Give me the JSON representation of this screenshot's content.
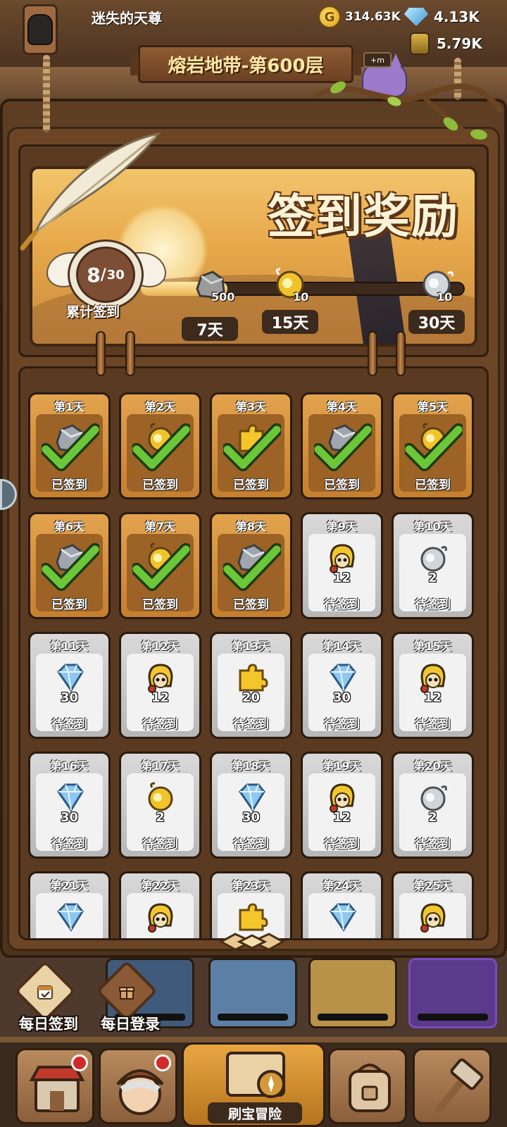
{
  "player": {
    "name": "迷失的天尊"
  },
  "currencies": {
    "coins": {
      "symbol": "G",
      "value": "314.63K",
      "color": "#f2b51f"
    },
    "gems": {
      "value": "4.13K",
      "color": "#5cb8ea"
    },
    "potions": {
      "value": "5.79K"
    }
  },
  "stage": {
    "title": "熔岩地带-第600层"
  },
  "pet_badge": "+m",
  "signin": {
    "title": "签到奖励",
    "progress": {
      "current": "8",
      "total": "30",
      "caption": "累计签到",
      "fraction": 0.267
    },
    "milestones": [
      {
        "reward": "stone-icon",
        "qty": "500",
        "day": "7天"
      },
      {
        "reward": "gold-scroll-icon",
        "qty": "10",
        "day": "15天"
      },
      {
        "reward": "silver-scroll-icon",
        "qty": "10",
        "day": "30天"
      }
    ]
  },
  "days": [
    {
      "day": "第1天",
      "reward": "stone-icon",
      "amount": "",
      "status": "已签到",
      "done": true
    },
    {
      "day": "第2天",
      "reward": "gold-scroll-icon",
      "amount": "",
      "status": "已签到",
      "done": true
    },
    {
      "day": "第3天",
      "reward": "puzzle-icon",
      "amount": "",
      "status": "已签到",
      "done": true
    },
    {
      "day": "第4天",
      "reward": "stone-icon",
      "amount": "",
      "status": "已签到",
      "done": true
    },
    {
      "day": "第5天",
      "reward": "gold-scroll-icon",
      "amount": "",
      "status": "已签到",
      "done": true
    },
    {
      "day": "第6天",
      "reward": "stone-icon",
      "amount": "",
      "status": "已签到",
      "done": true
    },
    {
      "day": "第7天",
      "reward": "gold-scroll-icon",
      "amount": "",
      "status": "已签到",
      "done": true
    },
    {
      "day": "第8天",
      "reward": "stone-icon",
      "amount": "",
      "status": "已签到",
      "done": true
    },
    {
      "day": "第9天",
      "reward": "hero-token-icon",
      "amount": "12",
      "status": "待签到",
      "done": false
    },
    {
      "day": "第10天",
      "reward": "silver-scroll-icon",
      "amount": "2",
      "status": "待签到",
      "done": false
    },
    {
      "day": "第11天",
      "reward": "gem-icon",
      "amount": "30",
      "status": "待签到",
      "done": false
    },
    {
      "day": "第12天",
      "reward": "hero-token-icon",
      "amount": "12",
      "status": "待签到",
      "done": false
    },
    {
      "day": "第13天",
      "reward": "puzzle-icon",
      "amount": "20",
      "status": "待签到",
      "done": false
    },
    {
      "day": "第14天",
      "reward": "gem-icon",
      "amount": "30",
      "status": "待签到",
      "done": false
    },
    {
      "day": "第15天",
      "reward": "hero-token-icon",
      "amount": "12",
      "status": "待签到",
      "done": false
    },
    {
      "day": "第16天",
      "reward": "gem-icon",
      "amount": "30",
      "status": "待签到",
      "done": false
    },
    {
      "day": "第17天",
      "reward": "gold-scroll-icon",
      "amount": "2",
      "status": "待签到",
      "done": false
    },
    {
      "day": "第18天",
      "reward": "gem-icon",
      "amount": "30",
      "status": "待签到",
      "done": false
    },
    {
      "day": "第19天",
      "reward": "hero-token-icon",
      "amount": "12",
      "status": "待签到",
      "done": false
    },
    {
      "day": "第20天",
      "reward": "silver-scroll-icon",
      "amount": "2",
      "status": "待签到",
      "done": false
    },
    {
      "day": "第21天",
      "reward": "gem-icon",
      "amount": "",
      "status": "",
      "done": false
    },
    {
      "day": "第22天",
      "reward": "hero-token-icon",
      "amount": "",
      "status": "",
      "done": false
    },
    {
      "day": "第23天",
      "reward": "puzzle-icon",
      "amount": "",
      "status": "",
      "done": false
    },
    {
      "day": "第24天",
      "reward": "gem-icon",
      "amount": "",
      "status": "",
      "done": false
    },
    {
      "day": "第25天",
      "reward": "hero-token-icon",
      "amount": "",
      "status": "",
      "done": false
    }
  ],
  "daily_buttons": [
    {
      "label": "每日签到",
      "icon": "calendar-icon"
    },
    {
      "label": "每日登录",
      "icon": "gift-icon"
    }
  ],
  "bottom_nav": [
    {
      "name": "shop",
      "icon": "shop-icon",
      "badge": true
    },
    {
      "name": "hero",
      "icon": "hero-portrait-icon",
      "badge": true
    },
    {
      "name": "treasure",
      "label": "刷宝冒险",
      "icon": "treasure-map-icon"
    },
    {
      "name": "bag",
      "icon": "backpack-icon",
      "badge": false
    },
    {
      "name": "forge",
      "icon": "hammer-icon",
      "badge": false
    }
  ],
  "colors": {
    "done": "#e3a34d",
    "pending": "#d0d0d0",
    "check": "#6cc63a",
    "wood": "#5e3e22"
  }
}
